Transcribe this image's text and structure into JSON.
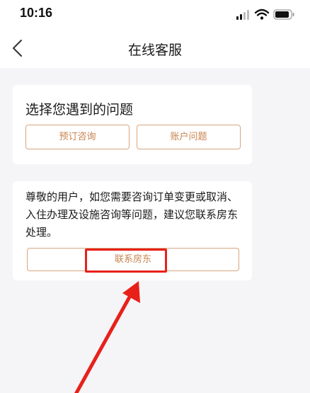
{
  "status_bar": {
    "time": "10:16"
  },
  "nav": {
    "title": "在线客服"
  },
  "problems_card": {
    "title": "选择您遇到的问题",
    "buttons": [
      "预订咨询",
      "账户问题"
    ]
  },
  "contact_card": {
    "message": "尊敬的用户，如您需要咨询订单变更或取消、入住办理及设施咨询等问题，建议您联系房东处理。",
    "button_label": "联系房东"
  },
  "colors": {
    "accent": "#c8834e",
    "button_border": "#d9a57c",
    "annotation_red": "#e8201a",
    "page_background": "#f5f5f7"
  },
  "icons": {
    "back": "chevron-left-icon",
    "signal": "cellular-signal-icon",
    "wifi": "wifi-icon",
    "battery": "battery-icon"
  }
}
